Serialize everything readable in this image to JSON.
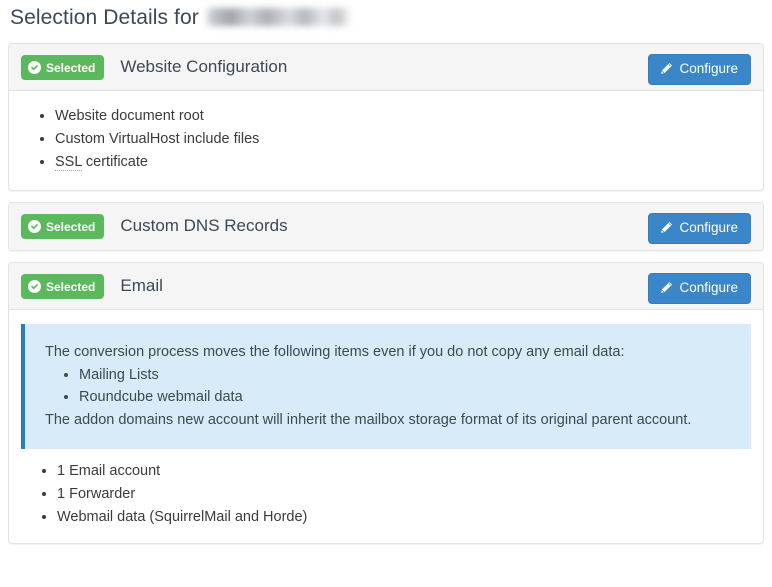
{
  "header": {
    "title_prefix": "Selection Details for",
    "redacted_domain": "",
    "redacted_is_blurred": true
  },
  "colors": {
    "badge_green": "#5cb85c",
    "button_blue": "#3a86c8",
    "button_blue_border": "#357ebd",
    "alert_bg": "#d7ecf8",
    "alert_border": "#2a7fba",
    "panel_header_bg": "#f5f5f5",
    "panel_border": "#e3e3e3",
    "heading_text": "#3c4858"
  },
  "icons": {
    "check_circle": "check-circle-icon",
    "pencil": "pencil-icon"
  },
  "common": {
    "selected_label": "Selected",
    "configure_label": "Configure"
  },
  "panels": [
    {
      "id": "website-configuration",
      "badge": "Selected",
      "title": "Website Configuration",
      "configure_label": "Configure",
      "has_configure": true,
      "has_body": true,
      "items": [
        {
          "text": "Website document root",
          "abbr": null
        },
        {
          "text": "Custom VirtualHost include files",
          "abbr": null
        },
        {
          "text": "SSL certificate",
          "abbr": "SSL"
        }
      ]
    },
    {
      "id": "custom-dns-records",
      "badge": "Selected",
      "title": "Custom DNS Records",
      "configure_label": "Configure",
      "has_configure": true,
      "has_body": false,
      "items": []
    },
    {
      "id": "email",
      "badge": "Selected",
      "title": "Email",
      "configure_label": "Configure",
      "has_configure": true,
      "has_body": true,
      "alert": {
        "intro": "The conversion process moves the following items even if you do not copy any email data:",
        "bullets": [
          "Mailing Lists",
          "Roundcube webmail data"
        ],
        "outro": "The addon domains new account will inherit the mailbox storage format of its original parent account."
      },
      "items": [
        {
          "text": "1 Email account",
          "abbr": null
        },
        {
          "text": "1 Forwarder",
          "abbr": null
        },
        {
          "text": "Webmail data (SquirrelMail and Horde)",
          "abbr": null
        }
      ]
    }
  ]
}
